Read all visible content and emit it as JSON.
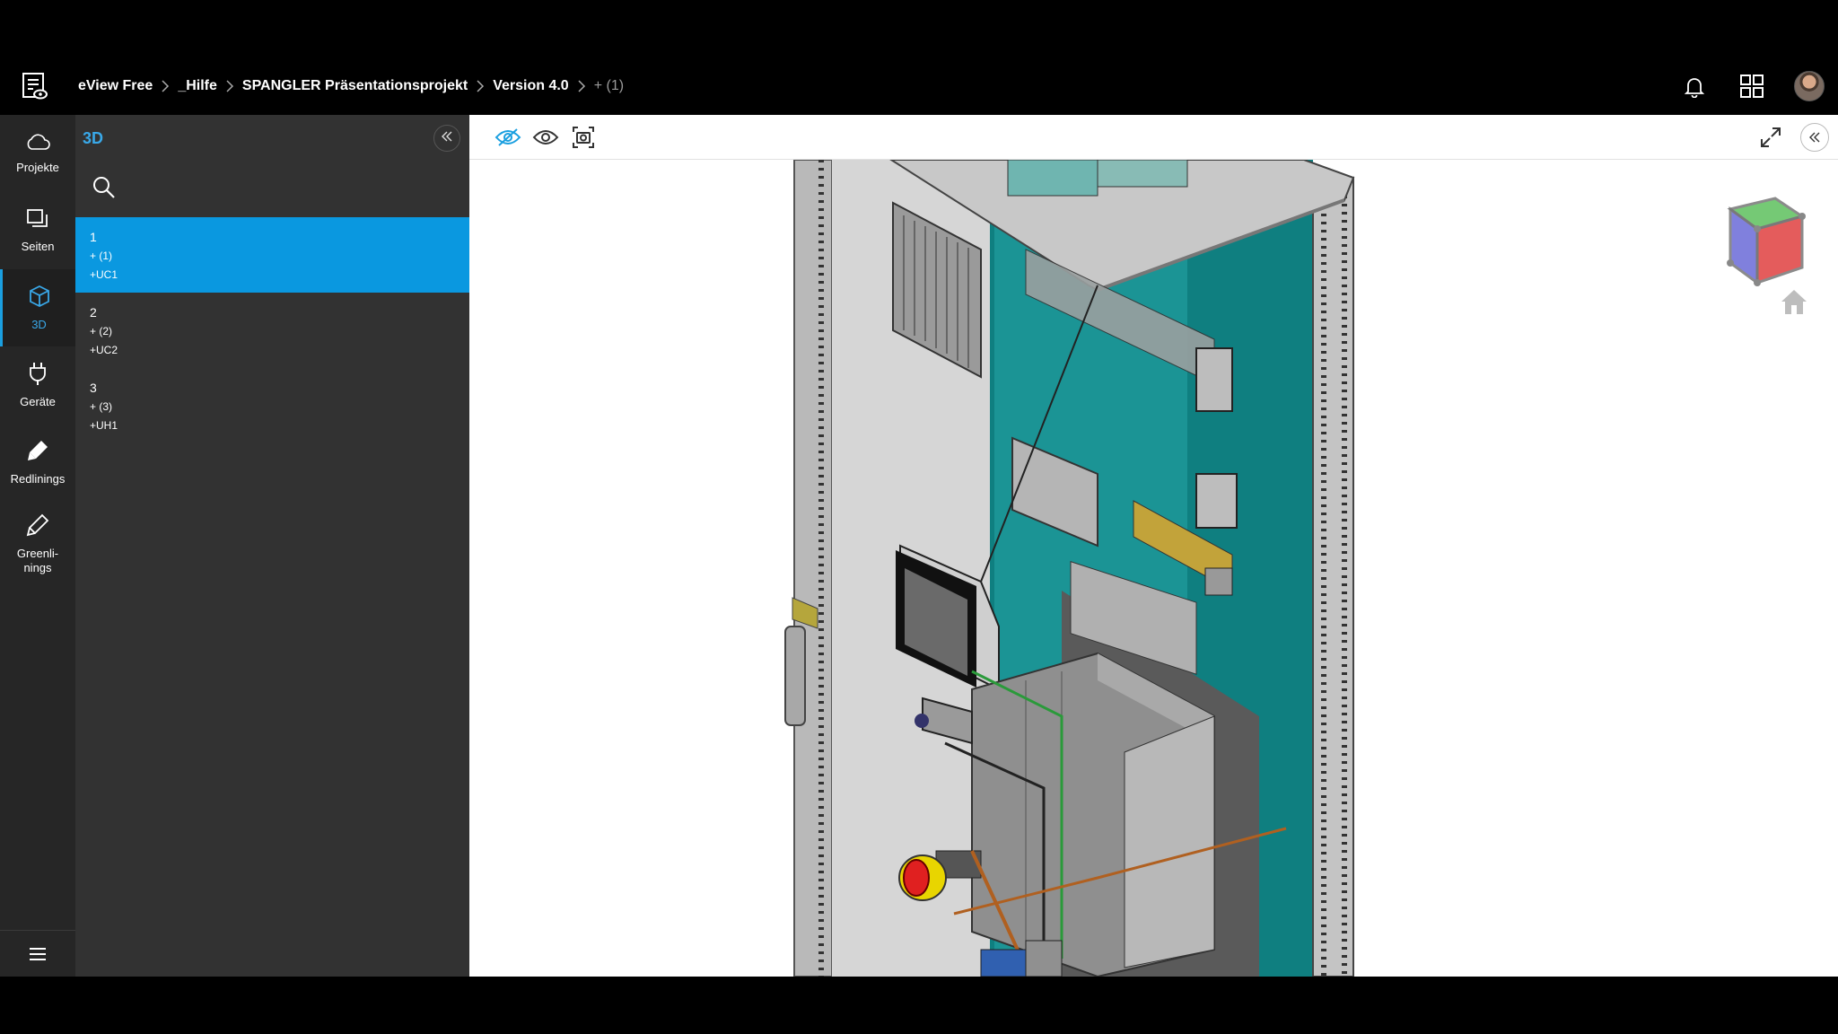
{
  "header": {
    "breadcrumb": [
      {
        "label": "eView Free"
      },
      {
        "label": "_Hilfe"
      },
      {
        "label": "SPANGLER Präsentationsprojekt"
      },
      {
        "label": "Version 4.0"
      },
      {
        "label": "+ (1)"
      }
    ],
    "icons": [
      "eview-logo-icon",
      "bell-icon",
      "apps-grid-icon",
      "user-avatar"
    ]
  },
  "nav": {
    "items": [
      {
        "label": "Projekte",
        "icon": "cloud-icon"
      },
      {
        "label": "Seiten",
        "icon": "pages-icon"
      },
      {
        "label": "3D",
        "icon": "cube-icon"
      },
      {
        "label": "Geräte",
        "icon": "plug-icon"
      },
      {
        "label": "Redlinings",
        "icon": "marker-icon"
      },
      {
        "label": "Greenli-",
        "label2": "nings",
        "icon": "pen-icon"
      }
    ],
    "active": "3D",
    "menu_icon": "hamburger-icon"
  },
  "panel": {
    "title": "3D",
    "items": [
      {
        "num": "1",
        "loc": "+ (1)",
        "code": "+UC1",
        "selected": true
      },
      {
        "num": "2",
        "loc": "+ (2)",
        "code": "+UC2",
        "selected": false
      },
      {
        "num": "3",
        "loc": "+ (3)",
        "code": "+UH1",
        "selected": false
      }
    ]
  },
  "viewer": {
    "toolbar_icons": [
      "hide-icon",
      "show-icon",
      "screenshot-icon",
      "fullscreen-icon",
      "collapse-icon"
    ],
    "accent": "#1a9fe0"
  }
}
